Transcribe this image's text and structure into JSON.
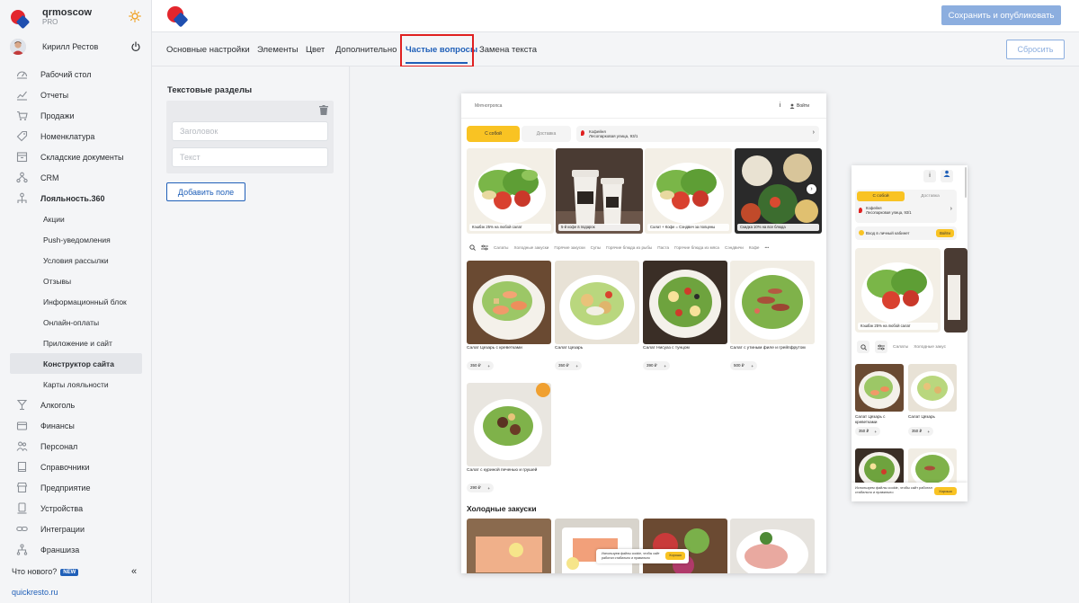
{
  "brand": {
    "name": "qrmoscow",
    "plan": "PRO"
  },
  "user": {
    "name": "Кирилл Рестов"
  },
  "sidebar": {
    "items": [
      {
        "label": "Рабочий стол",
        "icon": "dashboard-icon"
      },
      {
        "label": "Отчеты",
        "icon": "reports-icon"
      },
      {
        "label": "Продажи",
        "icon": "cart-icon"
      },
      {
        "label": "Номенклатура",
        "icon": "tag-icon"
      },
      {
        "label": "Складские документы",
        "icon": "warehouse-icon"
      },
      {
        "label": "CRM",
        "icon": "crm-icon"
      },
      {
        "label": "Лояльность.360",
        "icon": "loyalty-icon"
      }
    ],
    "loyalty_sub": [
      "Акции",
      "Push-уведомления",
      "Условия рассылки",
      "Отзывы",
      "Информационный блок",
      "Онлайн-оплаты",
      "Приложение и сайт",
      "Конструктор сайта",
      "Карты лояльности"
    ],
    "items_after": [
      {
        "label": "Алкоголь",
        "icon": "glass-icon"
      },
      {
        "label": "Финансы",
        "icon": "finance-icon"
      },
      {
        "label": "Персонал",
        "icon": "staff-icon"
      },
      {
        "label": "Справочники",
        "icon": "book-icon"
      },
      {
        "label": "Предприятие",
        "icon": "store-icon"
      },
      {
        "label": "Устройства",
        "icon": "device-icon"
      },
      {
        "label": "Интеграции",
        "icon": "link-icon"
      },
      {
        "label": "Франшиза",
        "icon": "network-icon"
      }
    ],
    "whats_new": "Что нового?",
    "new_badge": "NEW",
    "collapse_glyph": "«",
    "site_link": "quickresto.ru"
  },
  "toolbar": {
    "publish_label": "Сохранить и опубликовать",
    "reset_label": "Сбросить"
  },
  "tabs": [
    {
      "label": "Основные настройки"
    },
    {
      "label": "Элементы"
    },
    {
      "label": "Цвет"
    },
    {
      "label": "Дополнительно"
    },
    {
      "label": "Частые вопросы"
    },
    {
      "label": "Замена текста"
    }
  ],
  "active_tab": "Частые вопросы",
  "editor": {
    "section_title": "Текстовые разделы",
    "title_placeholder": "Заголовок",
    "text_placeholder": "Текст",
    "add_field_label": "Добавить поле"
  },
  "preview": {
    "site_name": "Мятнотропса",
    "info_glyph": "i",
    "login_label": "Войти",
    "pickup_label": "С собой",
    "delivery_label": "Доставка",
    "address_line1": "Кофейня",
    "address_line2": "Лесопарковая улица, 93/1",
    "next_glyph": "›",
    "promos": [
      "Кэшбэк 25% на любой салат",
      "5-й кофе в подарок",
      "Салат + Кофе = Сэндвич за полцены",
      "Скидка 10% на все блюда"
    ],
    "categories": [
      "Салаты",
      "Холодные закуски",
      "Горячие закуски",
      "Супы",
      "Горячие блюда из рыбы",
      "Паста",
      "Горячие блюда из мяса",
      "Сэндвичи",
      "Кофе",
      "•••"
    ],
    "products": [
      {
        "name": "Салат Цезарь с креветками",
        "price": "350 ₽"
      },
      {
        "name": "Салат Цезарь",
        "price": "350 ₽"
      },
      {
        "name": "Салат Нисуаз с тунцом",
        "price": "390 ₽"
      },
      {
        "name": "Салат с утиным филе и грейпфрутом",
        "price": "500 ₽"
      },
      {
        "name": "Салат с куриной печенью и грушей",
        "price": "290 ₽"
      }
    ],
    "plus_glyph": "+",
    "section_cold": "Холодные закуски",
    "cookie_text": "Используем файлы cookie, чтобы сайт работал стабильно и правильно",
    "cookie_btn": "Хорошо"
  },
  "mobile": {
    "info_glyph": "i",
    "pickup_label": "С собой",
    "delivery_label": "Доставка",
    "address_line1": "Кофейня",
    "address_line2": "Лесопарковая улица, 93/1",
    "lk_label": "Вход в личный кабинет",
    "lk_btn": "Войти",
    "promo": "Кэшбэк 25% на любой салат",
    "categories": [
      "Салаты",
      "Холодные закус"
    ],
    "products": [
      {
        "name": "Салат Цезарь с креветками",
        "price": "350 ₽"
      },
      {
        "name": "Салат Цезарь",
        "price": "350 ₽"
      }
    ],
    "cookie_text": "Используем файлы cookie, чтобы сайт работал стабильно и правильно",
    "cookie_btn": "Хорошо"
  },
  "colors": {
    "accent": "#1f5fb8",
    "publish": "#8caedf",
    "highlight": "#e02020",
    "preview_accent": "#f9c323"
  }
}
